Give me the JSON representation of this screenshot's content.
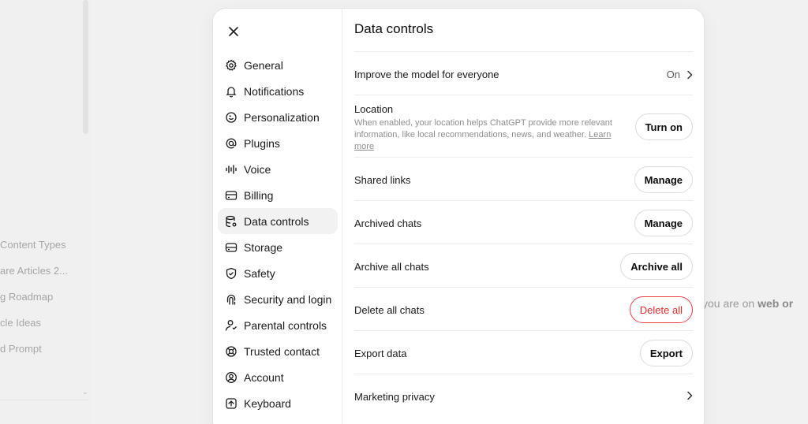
{
  "background": {
    "sidebar_items": [
      "Content Types",
      "are Articles 2...",
      "g Roadmap",
      "cle Ideas",
      "d Prompt"
    ],
    "main_text_prefix": "you are on ",
    "main_text_bold": "web or"
  },
  "modal": {
    "nav": [
      {
        "label": "General",
        "icon": "gear-icon"
      },
      {
        "label": "Notifications",
        "icon": "bell-icon"
      },
      {
        "label": "Personalization",
        "icon": "personalization-icon"
      },
      {
        "label": "Plugins",
        "icon": "at-sign-icon"
      },
      {
        "label": "Voice",
        "icon": "voice-wave-icon"
      },
      {
        "label": "Billing",
        "icon": "credit-card-icon"
      },
      {
        "label": "Data controls",
        "icon": "database-gear-icon"
      },
      {
        "label": "Storage",
        "icon": "storage-drive-icon"
      },
      {
        "label": "Safety",
        "icon": "shield-icon"
      },
      {
        "label": "Security and login",
        "icon": "fingerprint-icon"
      },
      {
        "label": "Parental controls",
        "icon": "parental-person-icon"
      },
      {
        "label": "Trusted contact",
        "icon": "lifebuoy-icon"
      },
      {
        "label": "Account",
        "icon": "account-circle-icon"
      },
      {
        "label": "Keyboard",
        "icon": "keyboard-icon"
      }
    ],
    "active_nav": "Data controls",
    "title": "Data controls",
    "settings": {
      "improve_model": {
        "label": "Improve the model for everyone",
        "value": "On"
      },
      "location": {
        "label": "Location",
        "description": "When enabled, your location helps ChatGPT provide more relevant information, like local recommendations, news, and weather.",
        "link": "Learn more",
        "button": "Turn on"
      },
      "shared_links": {
        "label": "Shared links",
        "button": "Manage"
      },
      "archived_chats": {
        "label": "Archived chats",
        "button": "Manage"
      },
      "archive_all": {
        "label": "Archive all chats",
        "button": "Archive all"
      },
      "delete_all": {
        "label": "Delete all chats",
        "button": "Delete all"
      },
      "export_data": {
        "label": "Export data",
        "button": "Export"
      },
      "marketing_privacy": {
        "label": "Marketing privacy"
      }
    }
  },
  "colors": {
    "danger": "#e02e2a",
    "active_nav_bg": "#f2f2f2",
    "divider": "#ececec"
  }
}
